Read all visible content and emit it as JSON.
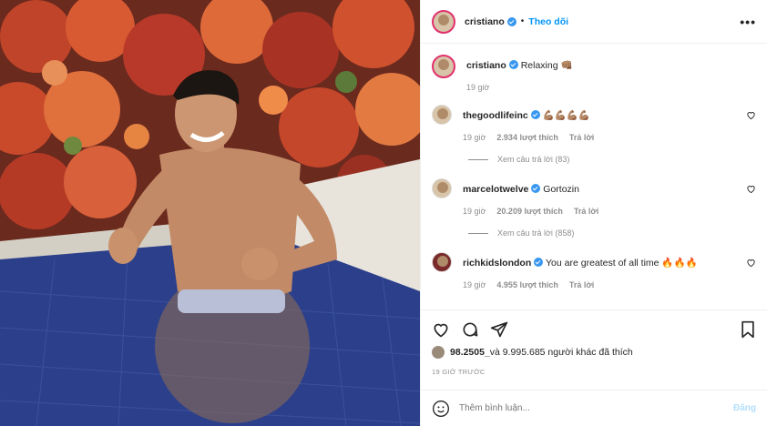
{
  "header": {
    "username": "cristiano",
    "separator": "•",
    "follow_label": "Theo dõi",
    "more_label": "•••"
  },
  "caption": {
    "username": "cristiano",
    "text": "Relaxing 👊🏽",
    "time": "19 giờ"
  },
  "comments": [
    {
      "username": "thegoodlifeinc",
      "text": "💪🏽💪🏽💪🏽💪🏽",
      "time": "19 giờ",
      "likes": "2.934 lượt thích",
      "reply_label": "Trả lời",
      "view_replies": "Xem câu trả lời (83)"
    },
    {
      "username": "marcelotwelve",
      "text": "Gortozin",
      "time": "19 giờ",
      "likes": "20.209 lượt thích",
      "reply_label": "Trả lời",
      "view_replies": "Xem câu trả lời (858)"
    },
    {
      "username": "richkidslondon",
      "text": "You are greatest of all time 🔥🔥🔥",
      "time": "19 giờ",
      "likes": "4.955 lượt thích",
      "reply_label": "Trả lời",
      "view_replies": ""
    }
  ],
  "likes": {
    "user": "98.2505_",
    "text": " và 9.995.685 người khác đã thích"
  },
  "time_ago": "19 GIỜ TRƯỚC",
  "add_comment": {
    "placeholder": "Thêm bình luận...",
    "post_label": "Đăng"
  },
  "colors": {
    "accent": "#0095f6",
    "verified": "#3897f0",
    "muted": "#8e8e8e"
  }
}
